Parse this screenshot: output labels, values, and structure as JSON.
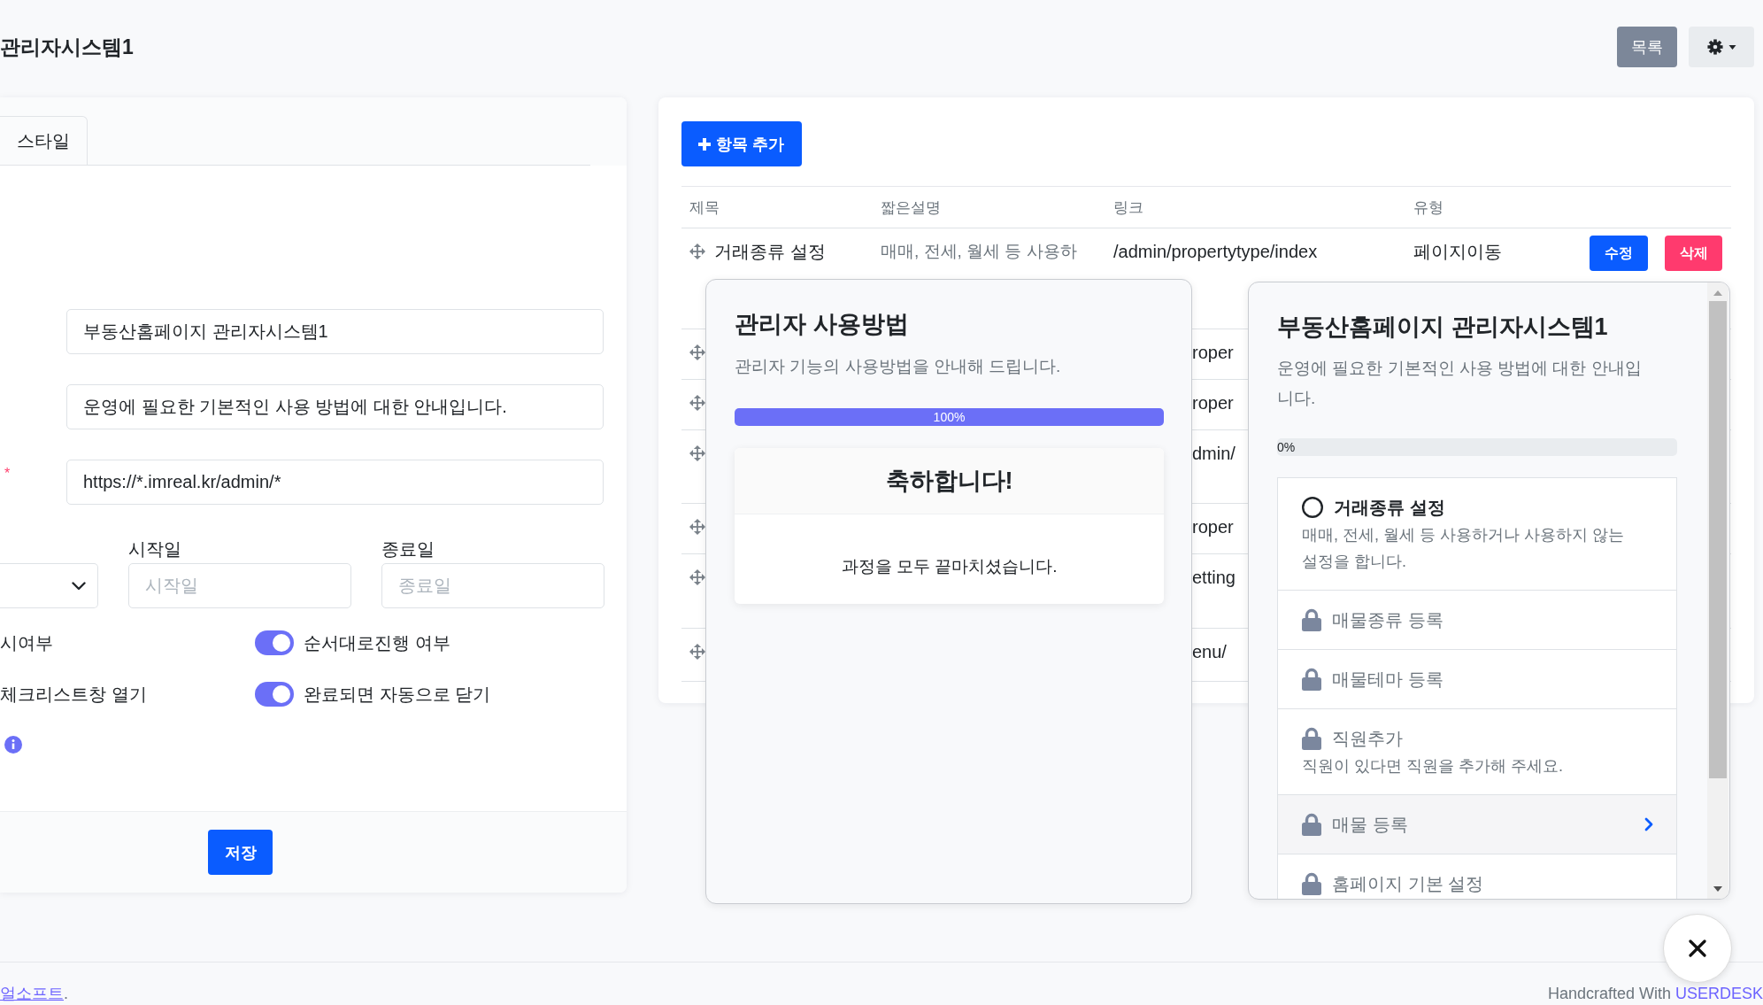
{
  "header": {
    "title": "관리자시스템1",
    "list_button": "목록"
  },
  "settings_panel": {
    "tabs": [
      {
        "label": "스타일",
        "selected": false
      }
    ],
    "fields": [
      {
        "value": "부동산홈페이지 관리자시스템1"
      },
      {
        "value": "운영에 필요한 기본적인 사용 방법에 대한 안내입니다."
      },
      {
        "value": "https://*.imreal.kr/admin/*",
        "required_mark": "*"
      }
    ],
    "dates": [
      {
        "label": "시작일",
        "placeholder": "시작일"
      },
      {
        "label": "종료일",
        "placeholder": "종료일"
      }
    ],
    "option_labels": [
      "시여부",
      "체크리스트창 열기"
    ],
    "switches": [
      {
        "label": "순서대로진행 여부",
        "on": true
      },
      {
        "label": "완료되면 자동으로 닫기",
        "on": true
      }
    ],
    "save_button": "저장"
  },
  "items_panel": {
    "add_button": "항목 추가",
    "columns": [
      "제목",
      "짧은설명",
      "링크",
      "유형"
    ],
    "rows": [
      {
        "title": "거래종류 설정",
        "description": "매매, 전세, 월세 등 사용하",
        "link": "/admin/propertytype/index",
        "type": "페이지이동",
        "edit_button": "수정",
        "delete_button": "삭제"
      },
      {
        "link": "roper"
      },
      {
        "link": "roper"
      },
      {
        "link": "dmin/"
      },
      {
        "link": "roper"
      },
      {
        "link": "etting"
      },
      {
        "link": "enu/"
      }
    ]
  },
  "guide_popup": {
    "title": "관리자 사용방법",
    "description": "관리자 기능의 사용방법을 안내해 드립니다.",
    "progress": {
      "level": 1,
      "label": "100%"
    },
    "result": {
      "title": "축하합니다!",
      "message": "과정을 모두 끝마치셨습니다."
    }
  },
  "checklist_popup": {
    "title": "부동산홈페이지 관리자시스템1",
    "description": "운영에 필요한 기본적인 사용 방법에 대한 안내입니다.",
    "progress": {
      "level": 0,
      "label": "0%"
    },
    "steps": [
      {
        "title": "거래종류 설정",
        "description": "매매, 전세, 월세 등 사용하거나 사용하지 않는 설정을 합니다.",
        "locked": false,
        "selected": false
      },
      {
        "title": "매물종류 등록",
        "locked": true,
        "selected": false
      },
      {
        "title": "매물테마 등록",
        "locked": true,
        "selected": false
      },
      {
        "title": "직원추가",
        "description": "직원이 있다면 직원을 추가해 주세요.",
        "locked": true,
        "selected": false
      },
      {
        "title": "매물 등록",
        "locked": true,
        "selected": true
      },
      {
        "title": "홈페이지 기본 설정",
        "locked": true,
        "selected": false
      }
    ]
  },
  "footer": {
    "company_link": "얼소프트",
    "company_suffix": ".",
    "credit": "Handcrafted With",
    "credit_link": "USERDESK"
  }
}
